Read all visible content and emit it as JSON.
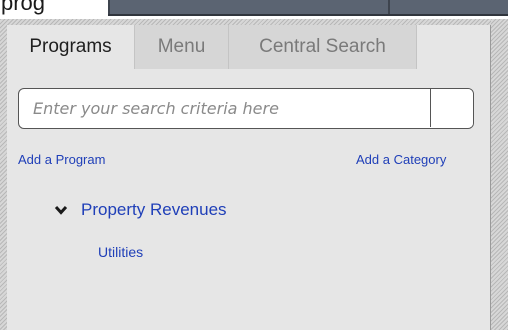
{
  "top_strip": {
    "cut_text": "prog"
  },
  "tabs": [
    {
      "label": "Programs",
      "active": true
    },
    {
      "label": "Menu",
      "active": false
    },
    {
      "label": "Central Search",
      "active": false
    }
  ],
  "search": {
    "placeholder": "Enter your search criteria here",
    "value": ""
  },
  "links": {
    "add_program": "Add a Program",
    "add_category": "Add a Category"
  },
  "tree": {
    "node": {
      "label": "Property Revenues",
      "expanded": true,
      "icon": "chevron-down-icon"
    },
    "children": [
      {
        "label": "Utilities"
      }
    ]
  },
  "colors": {
    "link": "#1f3fb8",
    "panel_bg": "#e6e6e6",
    "tab_inactive_bg": "#d6d6d6",
    "top_bar": "#5b6472"
  }
}
